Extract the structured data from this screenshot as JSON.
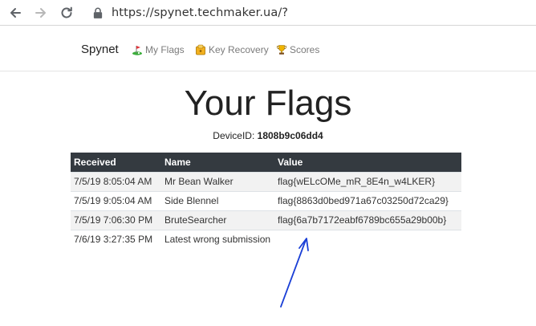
{
  "browser": {
    "url": "https://spynet.techmaker.ua/?"
  },
  "navbar": {
    "brand": "Spynet",
    "links": [
      {
        "label": "My Flags",
        "icon": "golf-flag-icon"
      },
      {
        "label": "Key Recovery",
        "icon": "key-folder-icon"
      },
      {
        "label": "Scores",
        "icon": "trophy-icon"
      }
    ]
  },
  "page": {
    "title": "Your Flags",
    "device_label": "DeviceID:",
    "device_id": "1808b9c06dd4"
  },
  "table": {
    "headers": [
      "Received",
      "Name",
      "Value"
    ],
    "rows": [
      {
        "received": "7/5/19 8:05:04 AM",
        "name": "Mr Bean Walker",
        "value": "flag{wELcOMe_mR_8E4n_w4LKER}"
      },
      {
        "received": "7/5/19 9:05:04 AM",
        "name": "Side Blennel",
        "value": "flag{8863d0bed971a67c03250d72ca29}"
      },
      {
        "received": "7/5/19 7:06:30 PM",
        "name": "BruteSearcher",
        "value": "flag{6a7b7172eabf6789bc655a29b00b}"
      },
      {
        "received": "7/6/19 3:27:35 PM",
        "name": "Latest wrong submission",
        "value": ""
      }
    ]
  },
  "colors": {
    "header_bg": "#343a40",
    "annotation_arrow": "#1a3fd6"
  }
}
